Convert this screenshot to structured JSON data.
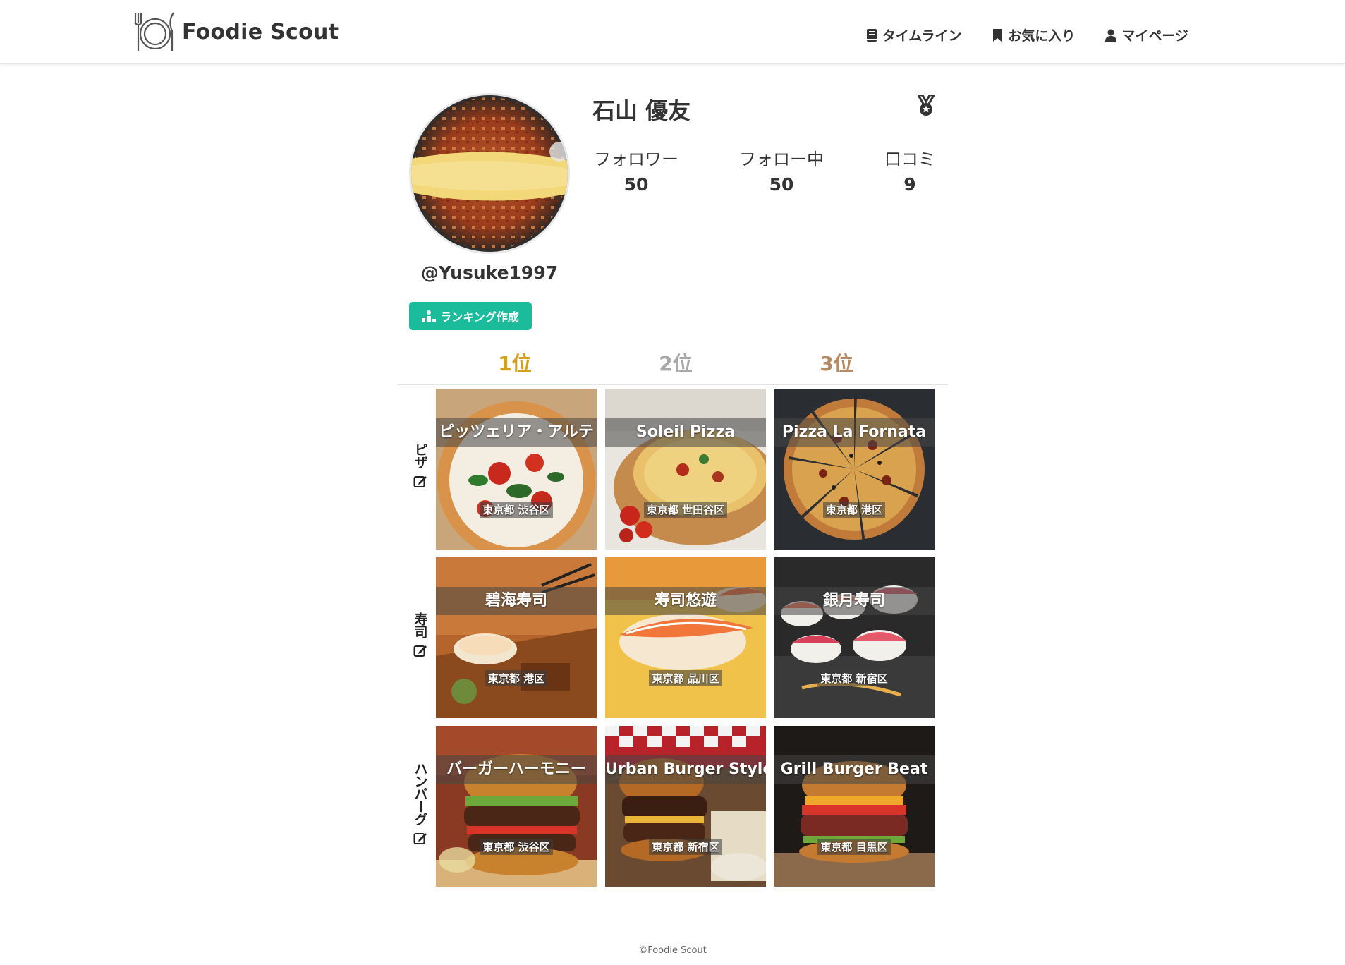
{
  "app": {
    "name": "Foodie Scout"
  },
  "nav": {
    "items": [
      {
        "label": "タイムライン",
        "icon": "book-icon"
      },
      {
        "label": "お気に入り",
        "icon": "bookmark-icon"
      },
      {
        "label": "マイページ",
        "icon": "user-icon"
      }
    ]
  },
  "profile": {
    "display_name": "石山 優友",
    "username": "@Yusuke1997",
    "ranking_button_label": "ランキング作成",
    "stats": [
      {
        "label": "フォロワー",
        "value": "50"
      },
      {
        "label": "フォロー中",
        "value": "50"
      },
      {
        "label": "口コミ",
        "value": "9"
      }
    ]
  },
  "ranks": {
    "first": "1位",
    "second": "2位",
    "third": "3位"
  },
  "categories": [
    {
      "name": "ピザ",
      "restaurants": [
        {
          "name": "ピッツェリア・アルテ",
          "location": "東京都 渋谷区"
        },
        {
          "name": "Soleil Pizza",
          "location": "東京都 世田谷区"
        },
        {
          "name": "Pizza La Fornata",
          "location": "東京都 港区"
        }
      ]
    },
    {
      "name": "寿司",
      "restaurants": [
        {
          "name": "碧海寿司",
          "location": "東京都 港区"
        },
        {
          "name": "寿司悠遊",
          "location": "東京都 品川区"
        },
        {
          "name": "銀月寿司",
          "location": "東京都 新宿区"
        }
      ]
    },
    {
      "name": "ハンバーグ",
      "restaurants": [
        {
          "name": "バーガーハーモニー",
          "location": "東京都 渋谷区"
        },
        {
          "name": "Urban Burger Style",
          "location": "東京都 新宿区"
        },
        {
          "name": "Grill Burger Beat",
          "location": "東京都 目黒区"
        }
      ]
    }
  ],
  "footer": {
    "copyright": "©Foodie Scout"
  },
  "colors": {
    "accent": "#1abc9c",
    "gold": "#d4a017",
    "silver": "#a8a8a8",
    "bronze": "#b58a63"
  }
}
